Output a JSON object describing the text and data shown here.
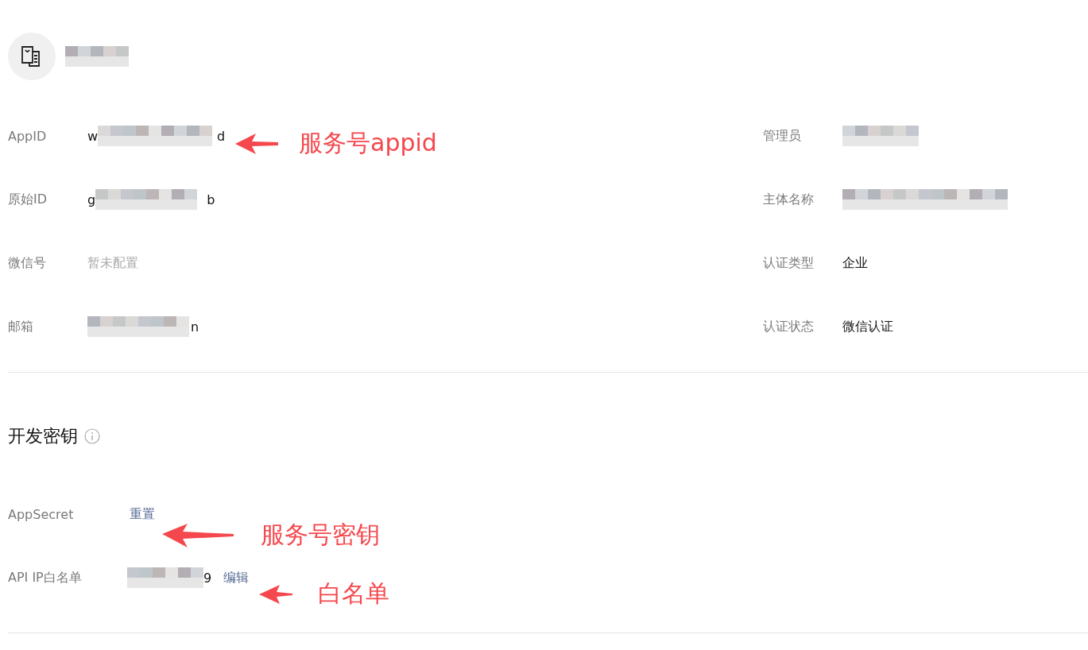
{
  "account": {
    "name": {
      "kind": "masked"
    }
  },
  "info": {
    "left": [
      {
        "label": "AppID",
        "value": {
          "kind": "masked",
          "start": "w",
          "end": "d"
        }
      },
      {
        "label": "原始ID",
        "value": {
          "kind": "masked",
          "start": "g",
          "end": "b"
        }
      },
      {
        "label": "微信号",
        "value": {
          "kind": "muted",
          "text": "暂未配置"
        }
      },
      {
        "label": "邮箱",
        "value": {
          "kind": "masked",
          "end": "n"
        }
      }
    ],
    "right": [
      {
        "label": "管理员",
        "value": {
          "kind": "masked"
        }
      },
      {
        "label": "主体名称",
        "value": {
          "kind": "masked"
        }
      },
      {
        "label": "认证类型",
        "value": {
          "kind": "text",
          "text": "企业"
        }
      },
      {
        "label": "认证状态",
        "value": {
          "kind": "text",
          "text": "微信认证"
        }
      }
    ]
  },
  "dev_keys": {
    "title": "开发密钥",
    "rows": [
      {
        "label": "AppSecret",
        "links": [
          "重置"
        ]
      },
      {
        "label": "API IP白名单",
        "value": {
          "kind": "masked",
          "end": "9"
        },
        "links": [
          "编辑"
        ]
      }
    ]
  },
  "annotations": [
    {
      "text": "服务号appid"
    },
    {
      "text": "服务号密钥"
    },
    {
      "text": "白名单"
    }
  ]
}
